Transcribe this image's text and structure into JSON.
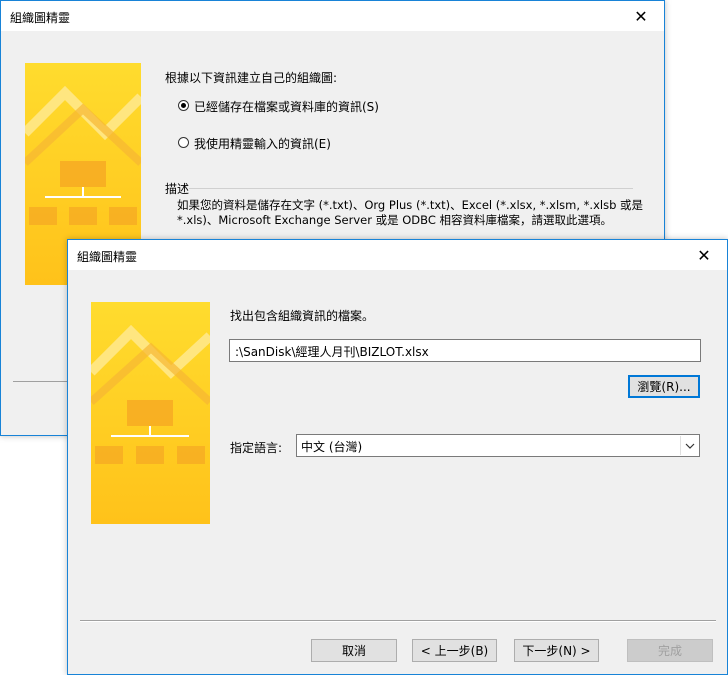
{
  "back_dialog": {
    "title": "組織圖精靈",
    "prompt": "根據以下資訊建立自己的組織圖:",
    "option1_label": "已經儲存在檔案或資料庫的資訊(S)",
    "option2_label": "我使用精靈輸入的資訊(E)",
    "description_heading": "描述",
    "description_line1": "如果您的資料是儲存在文字 (*.txt)、Org Plus (*.txt)、Excel (*.xlsx, *.xlsm, *.xlsb 或是",
    "description_line2": "*.xls)、Microsoft Exchange Server 或是 ODBC 相容資料庫檔案，請選取此選項。"
  },
  "front_dialog": {
    "title": "組織圖精靈",
    "find_label": "找出包含組織資訊的檔案。",
    "file_path": ":\\SanDisk\\經理人月刊\\BIZLOT.xlsx",
    "browse_label": "瀏覽(R)...",
    "language_label": "指定語言:",
    "language_value": "中文 (台灣)",
    "cancel_label": "取消",
    "back_label": "< 上一步(B)",
    "next_label": "下一步(N) >",
    "finish_label": "完成"
  },
  "icons": {
    "close": "close-icon",
    "dropdown": "chevron-down-icon",
    "banner": "org-chart-banner"
  },
  "colors": {
    "accent": "#0078d7",
    "window_border": "#1883d7",
    "banner_yellow": "#ffd21f",
    "banner_orange": "#f5a623"
  }
}
